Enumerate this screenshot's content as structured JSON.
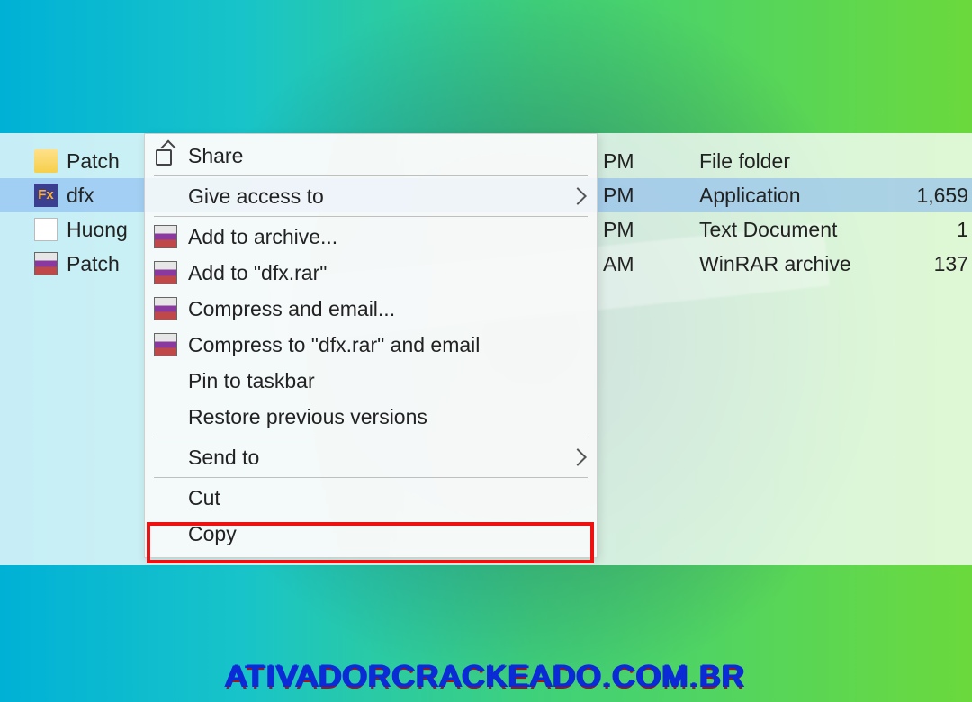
{
  "files": [
    {
      "name": "Patch",
      "icon": "folder",
      "time": "PM",
      "type": "File folder",
      "size": ""
    },
    {
      "name": "dfx",
      "icon": "fx",
      "time": "PM",
      "type": "Application",
      "size": "1,659",
      "selected": true
    },
    {
      "name": "Huong",
      "icon": "txt",
      "time": "PM",
      "type": "Text Document",
      "size": "1"
    },
    {
      "name": "Patch",
      "icon": "rar",
      "time": "AM",
      "type": "WinRAR archive",
      "size": "137"
    }
  ],
  "menu": {
    "share": "Share",
    "give_access_to": "Give access to",
    "add_to_archive": "Add to archive...",
    "add_to_dfx_rar": "Add to \"dfx.rar\"",
    "compress_and_email": "Compress and email...",
    "compress_to_dfx_rar_and_email": "Compress to \"dfx.rar\" and email",
    "pin_to_taskbar": "Pin to taskbar",
    "restore_previous_versions": "Restore previous versions",
    "send_to": "Send to",
    "cut": "Cut",
    "copy": "Copy"
  },
  "watermark": "ATIVADORCRACKEADO.COM.BR",
  "fx_icon_text": "Fx"
}
